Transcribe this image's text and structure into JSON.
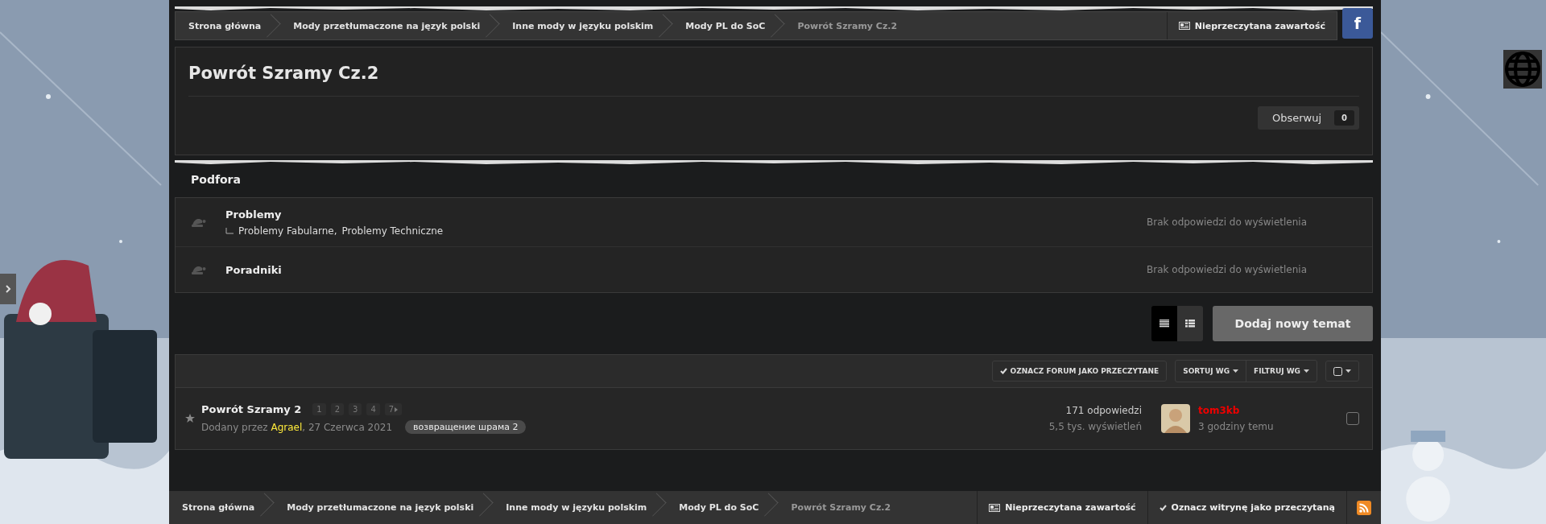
{
  "breadcrumb_top": {
    "items": [
      {
        "label": "Strona główna"
      },
      {
        "label": "Mody przetłumaczone na język polski"
      },
      {
        "label": "Inne mody w języku polskim"
      },
      {
        "label": "Mody PL do SoC"
      },
      {
        "label": "Powrót Szramy Cz.2",
        "current": true
      }
    ],
    "unread": "Nieprzeczytana zawartość",
    "facebook": "f"
  },
  "forum": {
    "title": "Powrót Szramy Cz.2",
    "follow": {
      "label": "Obserwuj",
      "count": "0"
    }
  },
  "subforums": {
    "title": "Podfora",
    "items": [
      {
        "name": "Problemy",
        "children": [
          {
            "name": "Problemy Fabularne,"
          },
          {
            "name": "Problemy Techniczne"
          }
        ],
        "last": "Brak odpowiedzi do wyświetlenia"
      },
      {
        "name": "Poradniki",
        "last": "Brak odpowiedzi do wyświetlenia"
      }
    ]
  },
  "view_modes": [
    {
      "kind": "table",
      "selected": true
    },
    {
      "kind": "grid",
      "selected": false
    }
  ],
  "new_topic": "Dodaj nowy temat",
  "topic_toolbar": {
    "mark_read": "OZNACZ FORUM JAKO PRZECZYTANE",
    "sort": "SORTUJ WG",
    "filter": "FILTRUJ WG"
  },
  "topics": [
    {
      "title": "Powrót Szramy 2",
      "pages": [
        "1",
        "2",
        "3",
        "4",
        "7"
      ],
      "by": "Dodany przez",
      "author": "Agrael",
      "date": ", 27 Czerwca 2021",
      "tag": "возвращение шрама 2",
      "replies": "171 odpowiedzi",
      "views": "5,5 tys. wyświetleń",
      "last_user": "tom3kb",
      "last_time": "3 godziny temu",
      "checked": false
    }
  ],
  "breadcrumb_bottom": {
    "items": [
      {
        "label": "Strona główna"
      },
      {
        "label": "Mody przetłumaczone na język polski"
      },
      {
        "label": "Inne mody w języku polskim"
      },
      {
        "label": "Mody PL do SoC"
      },
      {
        "label": "Powrót Szramy Cz.2",
        "current": true
      }
    ],
    "unread": "Nieprzeczytana zawartość",
    "mark_site_read": "Oznacz witrynę jako przeczytaną"
  }
}
